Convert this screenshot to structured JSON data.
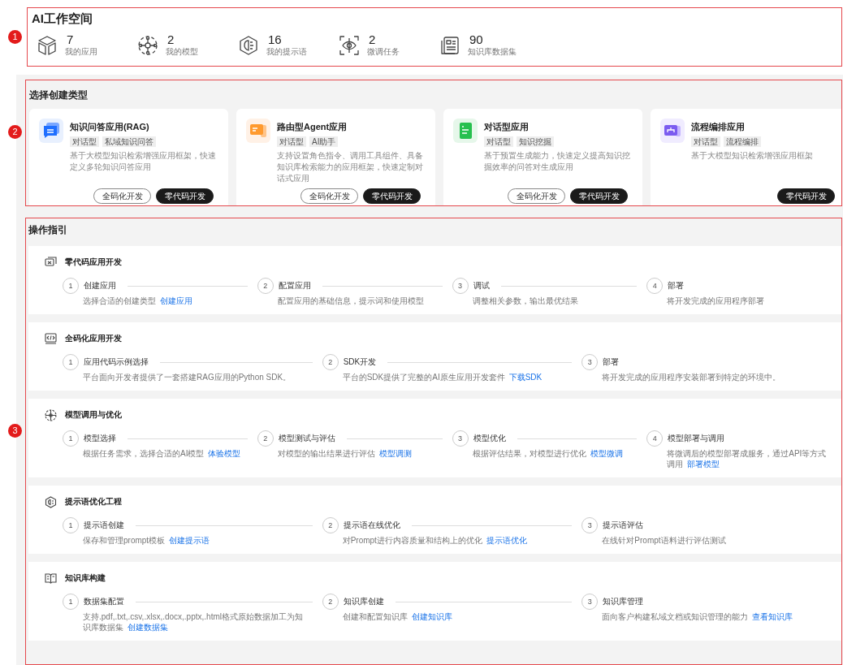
{
  "workspace": {
    "annotation": "1",
    "title": "AI工作空间",
    "stats": [
      {
        "value": "7",
        "label": "我的应用"
      },
      {
        "value": "2",
        "label": "我的模型"
      },
      {
        "value": "16",
        "label": "我的提示语"
      },
      {
        "value": "2",
        "label": "微调任务"
      },
      {
        "value": "90",
        "label": "知识库数据集"
      }
    ]
  },
  "create": {
    "annotation": "2",
    "title": "选择创建类型",
    "cards": [
      {
        "title": "知识问答应用(RAG)",
        "tags": [
          "对话型",
          "私域知识问答"
        ],
        "description": "基于大模型知识检索增强应用框架，快速定义多轮知识问答应用",
        "buttons": [
          {
            "label": "全码化开发",
            "kind": "outline"
          },
          {
            "label": "零代码开发",
            "kind": "solid"
          }
        ]
      },
      {
        "title": "路由型Agent应用",
        "tags": [
          "对话型",
          "AI助手"
        ],
        "description": "支持设置角色指令、调用工具组件、具备知识库检索能力的应用框架，快速定制对话式应用",
        "buttons": [
          {
            "label": "全码化开发",
            "kind": "outline"
          },
          {
            "label": "零代码开发",
            "kind": "solid"
          }
        ]
      },
      {
        "title": "对话型应用",
        "tags": [
          "对话型",
          "知识挖掘"
        ],
        "description": "基于预置生成能力，快速定义提高知识挖掘效率的问答对生成应用",
        "buttons": [
          {
            "label": "全码化开发",
            "kind": "outline"
          },
          {
            "label": "零代码开发",
            "kind": "solid"
          }
        ]
      },
      {
        "title": "流程编排应用",
        "tags": [
          "对话型",
          "流程编排"
        ],
        "description": "基于大模型知识检索增强应用框架",
        "buttons": [
          {
            "label": "零代码开发",
            "kind": "solid"
          }
        ]
      }
    ]
  },
  "guide": {
    "annotation": "3",
    "title": "操作指引",
    "sections": [
      {
        "title": "零代码应用开发",
        "steps": [
          {
            "number": "1",
            "title": "创建应用",
            "description": "选择合适的创建类型",
            "link": "创建应用"
          },
          {
            "number": "2",
            "title": "配置应用",
            "description": "配置应用的基础信息，提示词和使用模型"
          },
          {
            "number": "3",
            "title": "调试",
            "description": "调整相关参数，输出最优结果"
          },
          {
            "number": "4",
            "title": "部署",
            "description": "将开发完成的应用程序部署"
          }
        ]
      },
      {
        "title": "全码化应用开发",
        "steps": [
          {
            "number": "1",
            "title": "应用代码示例选择",
            "description": "平台面向开发者提供了一套搭建RAG应用的Python SDK。"
          },
          {
            "number": "2",
            "title": "SDK开发",
            "description": "平台的SDK提供了完整的AI原生应用开发套件",
            "link": "下载SDK"
          },
          {
            "number": "3",
            "title": "部署",
            "description": "将开发完成的应用程序安装部署到特定的环境中。"
          }
        ]
      },
      {
        "title": "模型调用与优化",
        "steps": [
          {
            "number": "1",
            "title": "模型选择",
            "description": "根据任务需求，选择合适的AI模型",
            "link": "体验模型"
          },
          {
            "number": "2",
            "title": "模型测试与评估",
            "description": "对模型的输出结果进行评估",
            "link": "模型调测"
          },
          {
            "number": "3",
            "title": "模型优化",
            "description": "根据评估结果，对模型进行优化",
            "link": "模型微调"
          },
          {
            "number": "4",
            "title": "模型部署与调用",
            "description": "将微调后的模型部署成服务，通过API等方式调用",
            "link": "部署模型"
          }
        ]
      },
      {
        "title": "提示语优化工程",
        "steps": [
          {
            "number": "1",
            "title": "提示语创建",
            "description": "保存和管理prompt模板",
            "link": "创建提示语"
          },
          {
            "number": "2",
            "title": "提示语在线优化",
            "description": "对Prompt进行内容质量和结构上的优化",
            "link": "提示语优化"
          },
          {
            "number": "3",
            "title": "提示语评估",
            "description": "在线针对Prompt语料进行评估测试"
          }
        ]
      },
      {
        "title": "知识库构建",
        "steps": [
          {
            "number": "1",
            "title": "数据集配置",
            "description": "支持.pdf,.txt,.csv,.xlsx,.docx,.pptx,.html格式原始数据加工为知识库数据集",
            "link": "创建数据集"
          },
          {
            "number": "2",
            "title": "知识库创建",
            "description": "创建和配置知识库",
            "link": "创建知识库"
          },
          {
            "number": "3",
            "title": "知识库管理",
            "description": "面向客户构建私域文档或知识管理的能力",
            "link": "查看知识库"
          }
        ]
      }
    ]
  }
}
